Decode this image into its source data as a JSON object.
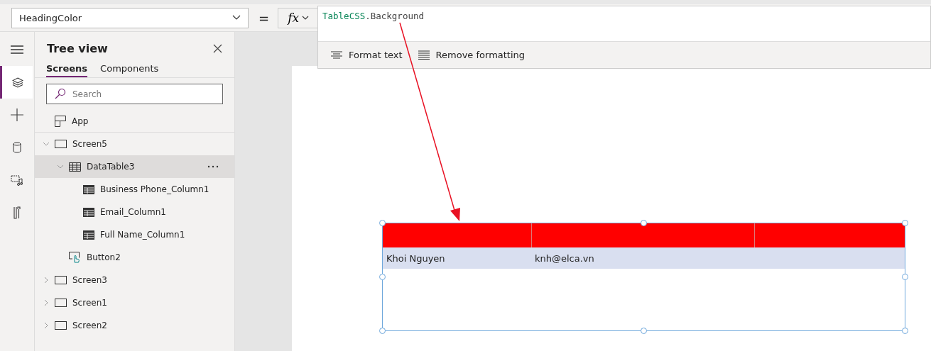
{
  "property_dropdown": {
    "value": "HeadingColor"
  },
  "equals": "=",
  "fx_button": {
    "label": "fx"
  },
  "formula": {
    "tokens": [
      {
        "text": "TableCSS",
        "kind": "identifier"
      },
      {
        "text": ".Background",
        "kind": "plain"
      }
    ]
  },
  "formula_toolbar": [
    {
      "label": "Format text",
      "kind": "format"
    },
    {
      "label": "Remove formatting",
      "kind": "remove"
    }
  ],
  "rail": [
    {
      "kind": "menu",
      "selected": false
    },
    {
      "kind": "layers",
      "selected": true
    },
    {
      "kind": "insert",
      "selected": false
    },
    {
      "kind": "data",
      "selected": false
    },
    {
      "kind": "media",
      "selected": false
    },
    {
      "kind": "tools",
      "selected": false
    }
  ],
  "tree_view": {
    "title": "Tree view",
    "tabs": [
      {
        "label": "Screens",
        "selected": true
      },
      {
        "label": "Components",
        "selected": false
      }
    ],
    "search": {
      "placeholder": "Search"
    },
    "items": [
      {
        "label": "App",
        "kind": "app",
        "selected": false
      },
      {
        "label": "Screen5",
        "kind": "screen",
        "expanded": true,
        "selected": false,
        "children": [
          {
            "label": "DataTable3",
            "kind": "table",
            "expanded": true,
            "selected": true,
            "children": [
              {
                "label": "Business Phone_Column1",
                "kind": "column",
                "selected": false
              },
              {
                "label": "Email_Column1",
                "kind": "column",
                "selected": false
              },
              {
                "label": "Full Name_Column1",
                "kind": "column",
                "selected": false
              }
            ]
          },
          {
            "label": "Button2",
            "kind": "button",
            "selected": false
          }
        ]
      },
      {
        "label": "Screen3",
        "kind": "screen",
        "expanded": false,
        "selected": false
      },
      {
        "label": "Screen1",
        "kind": "screen",
        "expanded": false,
        "selected": false
      },
      {
        "label": "Screen2",
        "kind": "screen",
        "expanded": false,
        "selected": false
      }
    ]
  },
  "data_table": {
    "rows": [
      {
        "column_1": "Khoi Nguyen",
        "column_2": "knh@elca.vn"
      }
    ]
  }
}
